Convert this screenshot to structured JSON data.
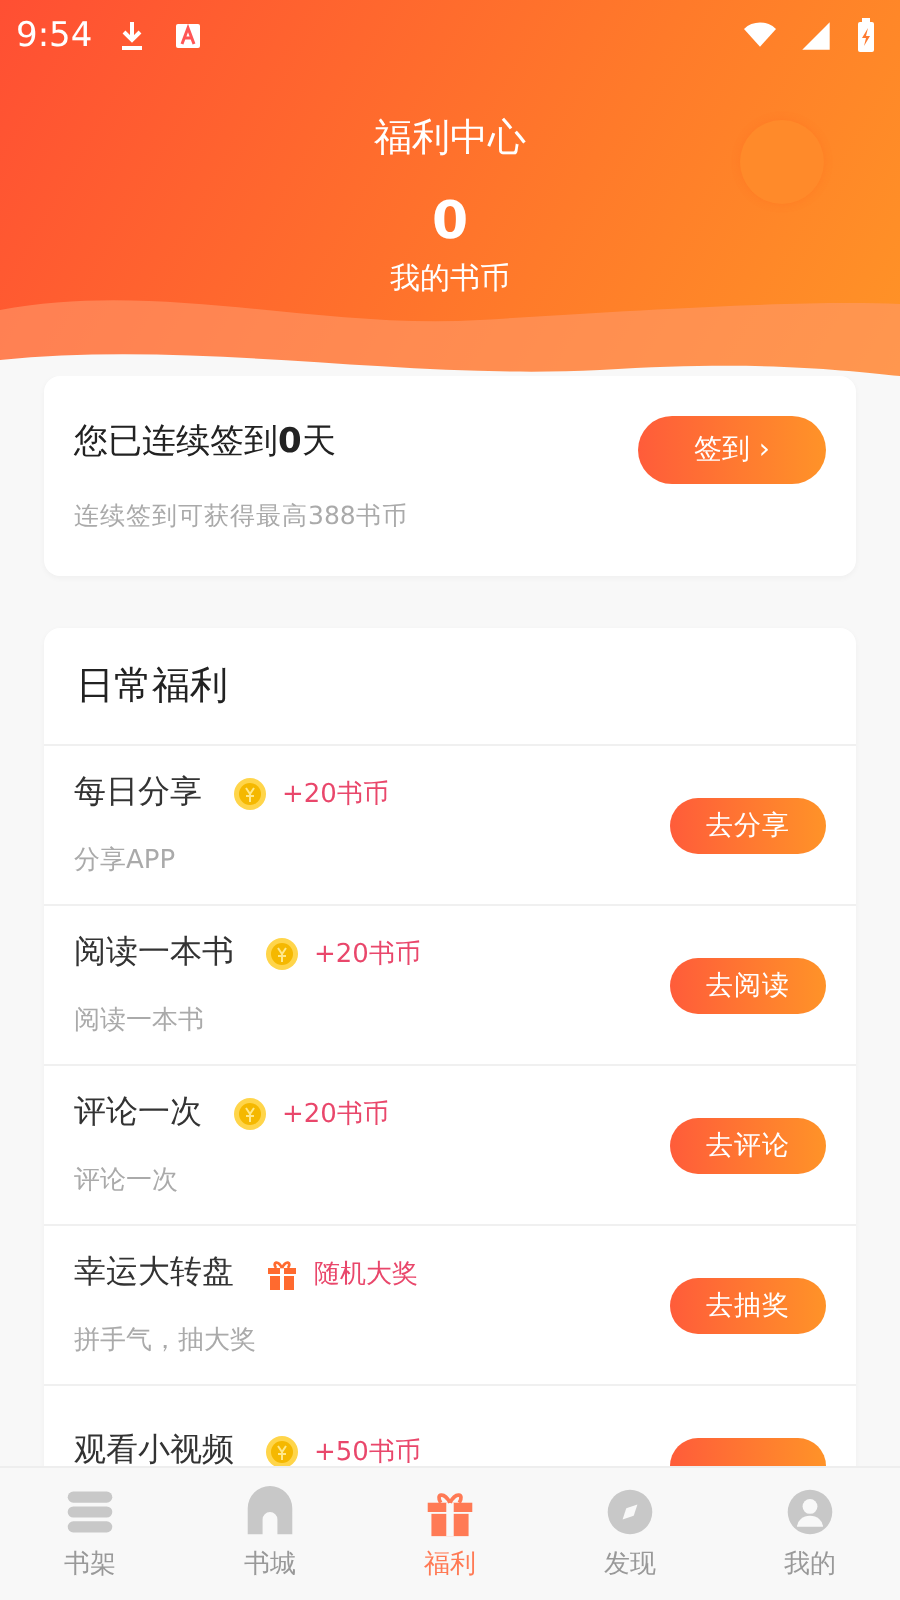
{
  "status_bar": {
    "time": "9:54"
  },
  "header": {
    "title": "福利中心",
    "coins": "0",
    "coins_label": "我的书币"
  },
  "checkin": {
    "text": "您已连续签到**0**天",
    "hint": "连续签到可获得最高388书币",
    "button": "签到",
    "button_icon": "›"
  },
  "daily": {
    "title": "日常福利",
    "items": [
      {
        "title": "每日分享",
        "kind": "coin",
        "reward": "+20书币",
        "subtitle": "分享APP",
        "action": "去分享"
      },
      {
        "title": "阅读一本书",
        "kind": "coin",
        "reward": "+20书币",
        "subtitle": "阅读一本书",
        "action": "去阅读"
      },
      {
        "title": "评论一次",
        "kind": "coin",
        "reward": "+20书币",
        "subtitle": "评论一次",
        "action": "去评论"
      },
      {
        "title": "幸运大转盘",
        "kind": "gift",
        "reward": "随机大奖",
        "subtitle": "拼手气，抽大奖",
        "action": "去抽奖"
      },
      {
        "title": "观看小视频",
        "kind": "coin",
        "reward": "+50书币",
        "action_hidden": true
      }
    ]
  },
  "tabs": [
    {
      "label": "书架",
      "kind": "shelf",
      "selected": false
    },
    {
      "label": "书城",
      "kind": "store",
      "selected": false
    },
    {
      "label": "福利",
      "kind": "gift",
      "selected": true
    },
    {
      "label": "发现",
      "kind": "discover",
      "selected": false
    },
    {
      "label": "我的",
      "kind": "me",
      "selected": false
    }
  ]
}
